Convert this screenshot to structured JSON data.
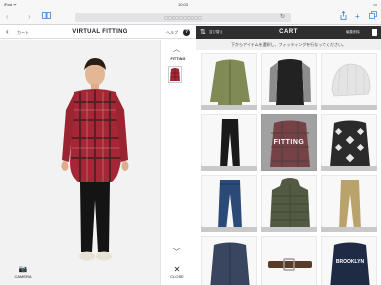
{
  "status_bar": {
    "left": "iPad ᯤ",
    "center": "10:03",
    "right": "▭"
  },
  "safari": {
    "back_icon": "chevron-left-icon",
    "forward_icon": "chevron-right-icon",
    "bookmarks_icon": "book-icon",
    "url": "▢▢▢▢▢▢▢▢▢▢",
    "reload_icon": "reload-icon",
    "actions": [
      "share-icon",
      "add-icon",
      "tabs-icon"
    ]
  },
  "fitting_header": {
    "back_label": "カート",
    "title": "VIRTUAL FITTING",
    "help_label": "ヘルプ",
    "help_icon": "?"
  },
  "side_strip": {
    "up_icon": "︿",
    "fitting_label": "FITTING",
    "down_icon": "﹀",
    "close_label": "CLOSE",
    "close_icon": "✕"
  },
  "camera": {
    "label": "CAMERA",
    "icon": "📷"
  },
  "cart_header": {
    "sort_icon": "⇅",
    "sort_label": "並び替え",
    "title": "CART",
    "delete_label": "編集削除"
  },
  "instruction": "下からアイテムを選択し、フィッティングを行なってください。",
  "fitting_overlay": "FITTING",
  "items": [
    {
      "name": "olive bomber jacket",
      "color": "#7f8a55",
      "caption": ""
    },
    {
      "name": "black jacket grey sleeves",
      "color": "#2a2a2a",
      "caption": ""
    },
    {
      "name": "white knit beanie",
      "color": "#e4e4e4",
      "caption": ""
    },
    {
      "name": "black slim pants",
      "color": "#1a1a1a",
      "caption": ""
    },
    {
      "name": "red check shirt",
      "color": "#9b2630",
      "caption": ""
    },
    {
      "name": "black white patterned cardigan",
      "color": "#2b2b2b",
      "caption": ""
    },
    {
      "name": "blue denim jeans",
      "color": "#2c4a78",
      "caption": ""
    },
    {
      "name": "olive quilted hooded jacket",
      "color": "#525a44",
      "caption": ""
    },
    {
      "name": "khaki chino pants",
      "color": "#b9a36b",
      "caption": ""
    },
    {
      "name": "navy shirt",
      "color": "#3a4560",
      "caption": ""
    },
    {
      "name": "brown leather belt",
      "color": "#5a3c26",
      "caption": ""
    },
    {
      "name": "navy brooklyn sweatshirt",
      "color": "#1f2a44",
      "caption": "BROOKLYN"
    }
  ]
}
